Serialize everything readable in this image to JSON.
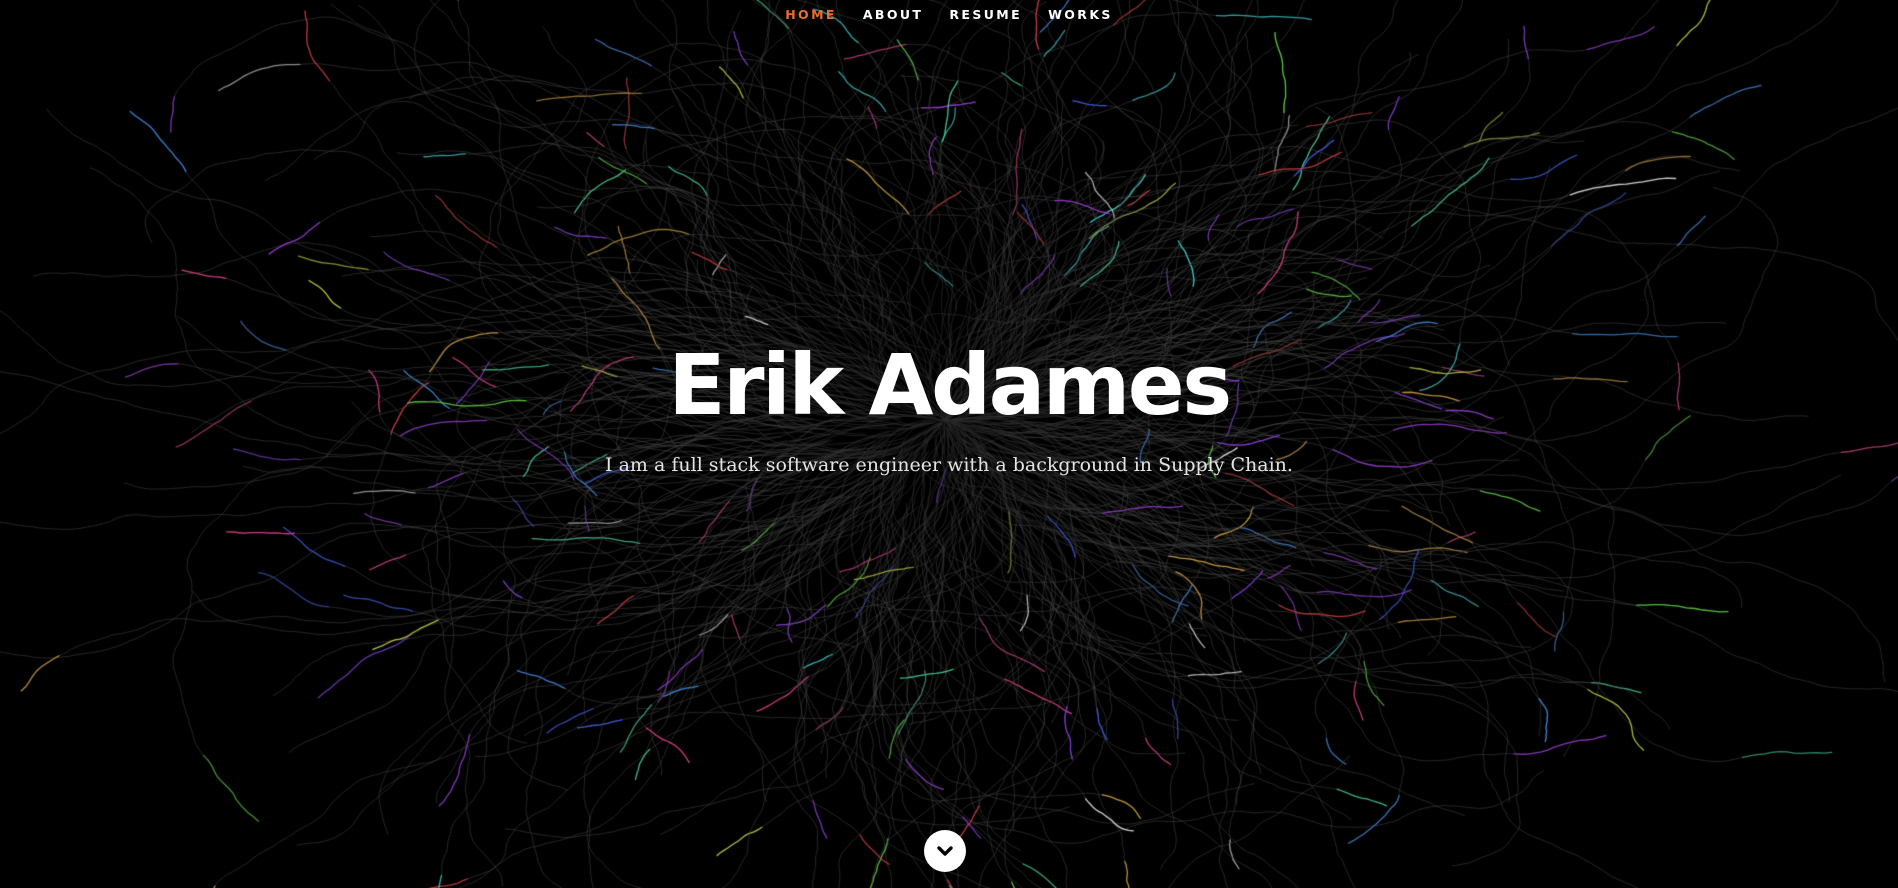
{
  "nav": {
    "items": [
      {
        "label": "HOME",
        "current": true
      },
      {
        "label": "ABOUT",
        "current": false
      },
      {
        "label": "RESUME",
        "current": false
      },
      {
        "label": "WORKS",
        "current": false
      }
    ]
  },
  "banner": {
    "title": "Erik Adames",
    "subtitle": "I am a full stack software engineer with a background in Supply Chain."
  },
  "scroll": {
    "icon": "chevron-down-icon"
  },
  "colors": {
    "background": "#000000",
    "accent": "#f06b2c",
    "text": "#ffffff",
    "subtitle": "#e4e4e4",
    "lines": "#2a2a2a"
  }
}
